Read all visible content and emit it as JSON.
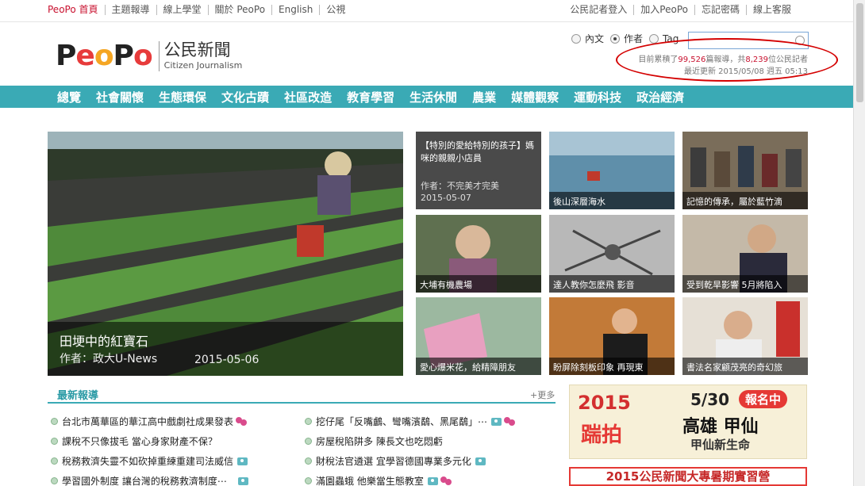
{
  "topbar": {
    "left_links": [
      "PeoPo 首頁",
      "主題報導",
      "線上學堂",
      "關於 PeoPo",
      "English",
      "公視"
    ],
    "right_links": [
      "公民記者登入",
      "加入PeoPo",
      "忘記密碼",
      "線上客服"
    ]
  },
  "logo": {
    "wordmark": [
      "P",
      "e",
      "o",
      "P",
      "o"
    ],
    "title_cn": "公民新聞",
    "title_en": "Citizen Journalism"
  },
  "search": {
    "options": [
      "內文",
      "作者",
      "Tag"
    ],
    "selected": "作者",
    "value": ""
  },
  "stats": {
    "prefix": "目前累積了",
    "reports": "99,526",
    "middle": "篇報導，共",
    "journalists": "8,239",
    "suffix": "位公民記者",
    "last_update": "最近更新 2015/05/08 週五 05:13"
  },
  "nav": {
    "items": [
      "總覽",
      "社會關懷",
      "生態環保",
      "文化古蹟",
      "社區改造",
      "教育學習",
      "生活休閒",
      "農業",
      "媒體觀察",
      "運動科技",
      "政治經濟"
    ]
  },
  "hero": {
    "title": "田埂中的紅寶石",
    "author": "作者：政大U-News",
    "date": "2015-05-06"
  },
  "tiles": [
    {
      "title": "【特別的愛給特別的孩子】媽咪的親親小店員",
      "author": "作者：不完美才完美",
      "date": "2015-05-07"
    },
    {
      "caption": "後山深層海水"
    },
    {
      "caption": "記憶的傳承，屬於藍竹滴"
    },
    {
      "caption": "大埔有機農場"
    },
    {
      "caption": "達人教你怎麼飛 影音"
    },
    {
      "caption": "受到乾旱影響 5月將陷入"
    },
    {
      "caption": "愛心爆米花，給精障朋友"
    },
    {
      "caption": "盼屏除刻板印象 再現東"
    },
    {
      "caption": "書法名家顧茂亮的奇幻旅"
    }
  ],
  "latest": {
    "heading": "最新報導",
    "more": "+更多",
    "left": [
      {
        "text": "台北市萬華區的華江高中戲劇社成果發表",
        "icons": [
          "video"
        ]
      },
      {
        "text": "課稅不只像拔毛 當心身家財產不保？",
        "icons": []
      },
      {
        "text": "稅務救濟失靈不如砍掉重練重建司法威信",
        "icons": [
          "photo"
        ]
      },
      {
        "text": "學習國外制度 讓台灣的稅務救濟制度⋯",
        "icons": [
          "photo"
        ]
      }
    ],
    "right": [
      {
        "text": "挖仔尾「反嘴鸕、彎嘴濱鷸、黑尾鷸」⋯",
        "icons": [
          "photo",
          "video"
        ]
      },
      {
        "text": "房屋稅陷阱多 陳長文也吃悶虧",
        "icons": []
      },
      {
        "text": "財稅法官遴選 宜學習德國專業多元化",
        "icons": [
          "photo"
        ]
      },
      {
        "text": "滿園蟲蛾 他樂當生態教室",
        "icons": [
          "photo",
          "video"
        ]
      }
    ]
  },
  "ad": {
    "year": "2015",
    "shot": "踹拍",
    "date": "5/30",
    "badge": "報名中",
    "place": "高雄 甲仙",
    "sub": "甲仙新生命",
    "banner2": "2015公民新聞大專暑期實習營"
  },
  "colors": {
    "nav_bg": "#3aaab5",
    "accent_red": "#c8102e",
    "annotation_red": "#d40000"
  }
}
